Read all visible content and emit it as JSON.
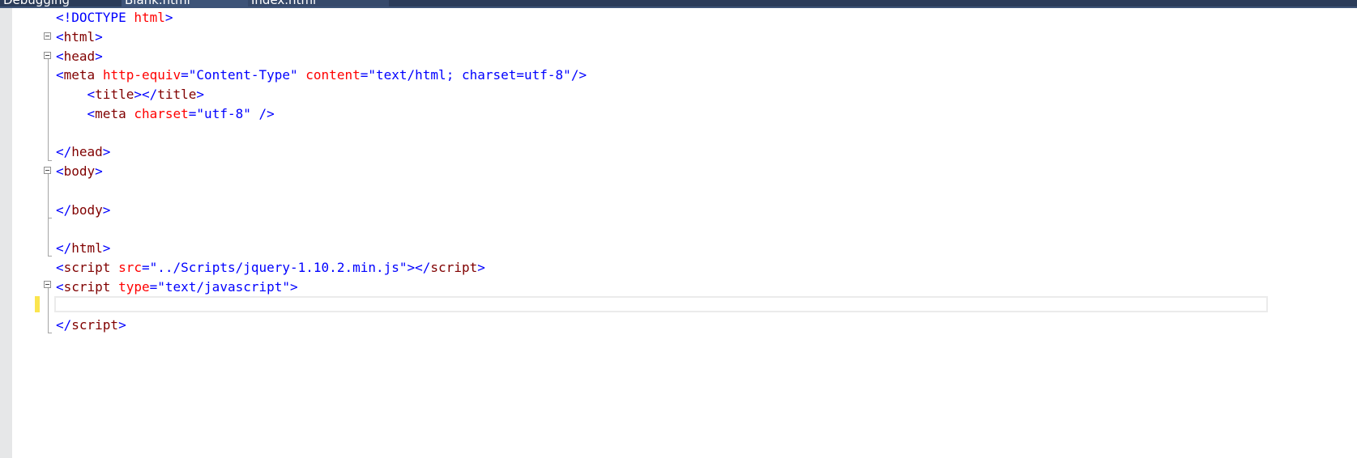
{
  "tabs": [
    {
      "label": "Debugging"
    },
    {
      "label": "Blank.html"
    },
    {
      "label": "Index.html"
    }
  ],
  "editor": {
    "lines": [
      {
        "indent": "",
        "tokens": [
          {
            "t": "punc",
            "v": "<!"
          },
          {
            "t": "doctype-kw",
            "v": "DOCTYPE"
          },
          {
            "t": "punc",
            "v": " "
          },
          {
            "t": "attr",
            "v": "html"
          },
          {
            "t": "punc",
            "v": ">"
          }
        ]
      },
      {
        "indent": "",
        "tokens": [
          {
            "t": "punc",
            "v": "<"
          },
          {
            "t": "tag",
            "v": "html"
          },
          {
            "t": "punc",
            "v": ">"
          }
        ]
      },
      {
        "indent": "",
        "tokens": [
          {
            "t": "punc",
            "v": "<"
          },
          {
            "t": "tag",
            "v": "head"
          },
          {
            "t": "punc",
            "v": ">"
          }
        ]
      },
      {
        "indent": "",
        "tokens": [
          {
            "t": "punc",
            "v": "<"
          },
          {
            "t": "tag",
            "v": "meta"
          },
          {
            "t": "punc",
            "v": " "
          },
          {
            "t": "attr",
            "v": "http-equiv"
          },
          {
            "t": "punc",
            "v": "="
          },
          {
            "t": "val",
            "v": "\"Content-Type\""
          },
          {
            "t": "punc",
            "v": " "
          },
          {
            "t": "attr",
            "v": "content"
          },
          {
            "t": "punc",
            "v": "="
          },
          {
            "t": "val",
            "v": "\"text/html; charset=utf-8\""
          },
          {
            "t": "punc",
            "v": "/>"
          }
        ]
      },
      {
        "indent": "    ",
        "tokens": [
          {
            "t": "punc",
            "v": "<"
          },
          {
            "t": "tag",
            "v": "title"
          },
          {
            "t": "punc",
            "v": "></"
          },
          {
            "t": "tag",
            "v": "title"
          },
          {
            "t": "punc",
            "v": ">"
          }
        ]
      },
      {
        "indent": "    ",
        "tokens": [
          {
            "t": "punc",
            "v": "<"
          },
          {
            "t": "tag",
            "v": "meta"
          },
          {
            "t": "punc",
            "v": " "
          },
          {
            "t": "attr",
            "v": "charset"
          },
          {
            "t": "punc",
            "v": "="
          },
          {
            "t": "val",
            "v": "\"utf-8\""
          },
          {
            "t": "punc",
            "v": " />"
          }
        ]
      },
      {
        "indent": "",
        "tokens": []
      },
      {
        "indent": "",
        "tokens": [
          {
            "t": "punc",
            "v": "</"
          },
          {
            "t": "tag",
            "v": "head"
          },
          {
            "t": "punc",
            "v": ">"
          }
        ]
      },
      {
        "indent": "",
        "tokens": [
          {
            "t": "punc",
            "v": "<"
          },
          {
            "t": "tag",
            "v": "body"
          },
          {
            "t": "punc",
            "v": ">"
          }
        ]
      },
      {
        "indent": "",
        "tokens": []
      },
      {
        "indent": "",
        "tokens": [
          {
            "t": "punc",
            "v": "</"
          },
          {
            "t": "tag",
            "v": "body"
          },
          {
            "t": "punc",
            "v": ">"
          }
        ]
      },
      {
        "indent": "",
        "tokens": []
      },
      {
        "indent": "",
        "tokens": [
          {
            "t": "punc",
            "v": "</"
          },
          {
            "t": "tag",
            "v": "html"
          },
          {
            "t": "punc",
            "v": ">"
          }
        ]
      },
      {
        "indent": "",
        "tokens": [
          {
            "t": "punc",
            "v": "<"
          },
          {
            "t": "tag",
            "v": "script"
          },
          {
            "t": "punc",
            "v": " "
          },
          {
            "t": "attr",
            "v": "src"
          },
          {
            "t": "punc",
            "v": "="
          },
          {
            "t": "val",
            "v": "\"../Scripts/jquery-1.10.2.min.js\""
          },
          {
            "t": "punc",
            "v": "></"
          },
          {
            "t": "tag",
            "v": "script"
          },
          {
            "t": "punc",
            "v": ">"
          }
        ]
      },
      {
        "indent": "",
        "tokens": [
          {
            "t": "punc",
            "v": "<"
          },
          {
            "t": "tag",
            "v": "script"
          },
          {
            "t": "punc",
            "v": " "
          },
          {
            "t": "attr",
            "v": "type"
          },
          {
            "t": "punc",
            "v": "="
          },
          {
            "t": "val",
            "v": "\"text/javascript\""
          },
          {
            "t": "punc",
            "v": ">"
          }
        ]
      },
      {
        "indent": "",
        "tokens": []
      },
      {
        "indent": "",
        "tokens": [
          {
            "t": "punc",
            "v": "</"
          },
          {
            "t": "tag",
            "v": "script"
          },
          {
            "t": "punc",
            "v": ">"
          }
        ]
      }
    ]
  },
  "colors": {
    "tag": "#800000",
    "punctuation": "#0000ff",
    "attribute": "#ff0000",
    "value": "#0000ff",
    "change_marker": "#fbe54e",
    "tab_strip": "#2b3c59"
  }
}
